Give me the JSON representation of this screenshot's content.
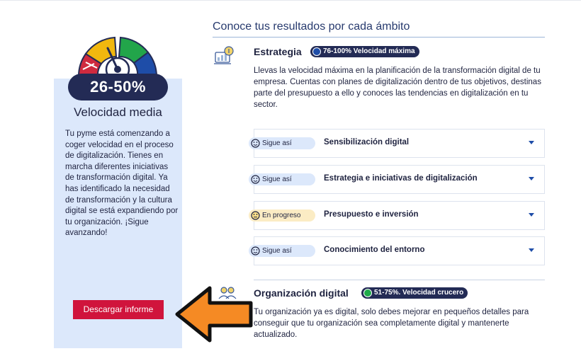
{
  "result": {
    "range": "26-50%",
    "title": "Velocidad media",
    "description": "Tu pyme está comenzando a coger velocidad en el proceso de digitalización. Tienes en marcha diferentes iniciativas de transformación digital. Ya has identificado la necesidad de transformación y la cultura digital se está expandiendo por tu organización. ¡Sigue avanzando!",
    "download_label": "Descargar informe"
  },
  "section": {
    "title": "Conoce tus resultados por cada ámbito"
  },
  "categories": [
    {
      "title": "Estrategia",
      "badge": "76-100% Velocidad máxima",
      "badge_color": "#1e4da8",
      "description": "Llevas la velocidad máxima en la planificación de la transformación digital de tu empresa. Cuentas con planes de digitalización dentro de tus objetivos, destinas parte del presupuesto a ello y conoces las tendencias en digitalización en tu sector.",
      "items": [
        {
          "status": "Sigue así",
          "status_color": "#dce8fb",
          "label": "Sensibilización digital"
        },
        {
          "status": "Sigue así",
          "status_color": "#dce8fb",
          "label": "Estrategia e iniciativas de digitalización"
        },
        {
          "status": "En progreso",
          "status_color": "#fbecc4",
          "label": "Presupuesto e inversión"
        },
        {
          "status": "Sigue así",
          "status_color": "#dce8fb",
          "label": "Conocimiento del entorno"
        }
      ]
    },
    {
      "title": "Organización digital",
      "badge": "51-75%. Velocidad crucero",
      "badge_color": "#1faa4a",
      "description": "Tu organización ya es digital, solo debes mejorar en pequeños detalles para conseguir que tu organización sea completamente digital y mantenerte actualizado."
    }
  ],
  "colors": {
    "accent": "#232b55",
    "button": "#d0143c",
    "panel": "#dce8fb",
    "arrow": "#f58a24",
    "gauge": [
      "#cf2a3f",
      "#f1b70f",
      "#22a54a",
      "#1e4da8"
    ]
  }
}
